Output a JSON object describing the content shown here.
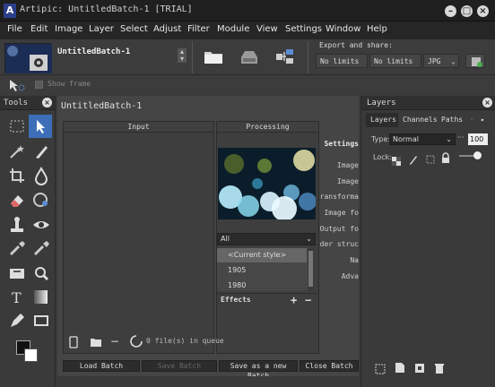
{
  "window": {
    "title": "Artipic: UntitledBatch-1 [TRIAL]",
    "logo": "A"
  },
  "menu": [
    "File",
    "Edit",
    "Image",
    "Layer",
    "Select",
    "Adjust",
    "Filter",
    "Module",
    "View",
    "Settings",
    "Window",
    "Help"
  ],
  "toolbar": {
    "preset_name": "UntitledBatch-1",
    "export_label": "Export and share:",
    "export_size1": "No limits",
    "export_size2": "No limits",
    "export_format": "JPG"
  },
  "options": {
    "show_frame_label": "Show frame"
  },
  "tools_panel": {
    "title": "Tools"
  },
  "batch": {
    "title": "UntitledBatch-1",
    "input_header": "Input",
    "processing_header": "Processing",
    "settings_header": "Settings",
    "filter_value": "All",
    "styles": [
      "<Current style>",
      "1905",
      "1980"
    ],
    "effects_label": "Effects",
    "settings_items": [
      "Image",
      "Image",
      "ransforma",
      "Image fo",
      "Output fo",
      "der struc",
      "Na",
      "Adva"
    ],
    "queue_text": "0 file(s) in queue",
    "buttons": {
      "load": "Load Batch",
      "save": "Save Batch",
      "save_as": "Save as a new Batch",
      "close": "Close Batch"
    }
  },
  "layers": {
    "title": "Layers",
    "tabs": [
      "Layers",
      "Channels",
      "Paths"
    ],
    "type_label": "Type:",
    "blend_mode": "Normal",
    "opacity": "100",
    "lock_label": "Lock:"
  },
  "icons": [
    "close-icon",
    "minimize-icon",
    "maximize-icon",
    "folder-icon",
    "save-icon",
    "share-icon",
    "pointer-icon",
    "brush-icon",
    "trash-icon"
  ]
}
